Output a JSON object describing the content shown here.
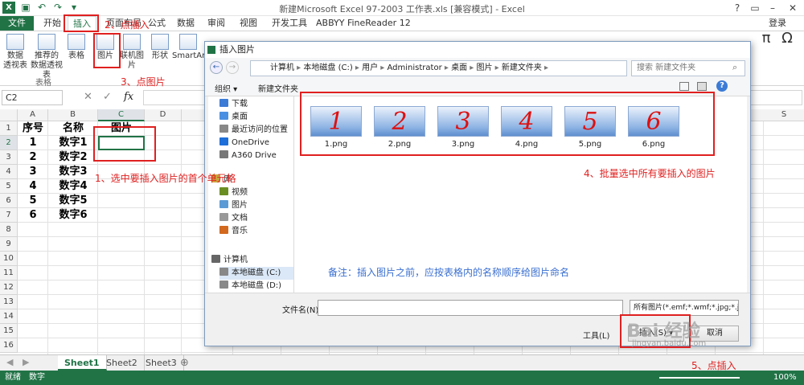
{
  "titlebar": {
    "title": "新建Microsoft Excel 97-2003 工作表.xls  [兼容模式] - Excel"
  },
  "tabs": {
    "file": "文件",
    "home": "开始",
    "insert": "插入",
    "layout": "页面布局",
    "formula": "公式",
    "data": "数据",
    "review": "审阅",
    "view": "视图",
    "dev": "开发工具",
    "abbyy": "ABBYY FineReader 12",
    "login": "登录"
  },
  "ribbon": {
    "pivot": "数据\n透视表",
    "recpivot": "推荐的\n数据透视表",
    "table": "表格",
    "group": "表格",
    "picture": "图片",
    "online": "联机图片",
    "shapes": "形状",
    "smartart": "SmartArt",
    "pi": "π",
    "omega": "Ω"
  },
  "formula": {
    "namebox": "C2",
    "fx": "fx"
  },
  "grid": {
    "columns": [
      "A",
      "B",
      "C",
      "D",
      "S"
    ],
    "rows": [
      "1",
      "2",
      "3",
      "4",
      "5",
      "6",
      "7",
      "8",
      "9",
      "10",
      "11",
      "12",
      "13",
      "14",
      "15",
      "16"
    ],
    "header": {
      "num": "序号",
      "name": "名称",
      "pic": "图片"
    },
    "data": [
      [
        "1",
        "数字1"
      ],
      [
        "2",
        "数字2"
      ],
      [
        "3",
        "数字3"
      ],
      [
        "4",
        "数字4"
      ],
      [
        "5",
        "数字5"
      ],
      [
        "6",
        "数字6"
      ]
    ]
  },
  "sheets": [
    "Sheet1",
    "Sheet2",
    "Sheet3"
  ],
  "status": {
    "ready": "就绪",
    "numlock": "数字",
    "zoom": "100%"
  },
  "dialog": {
    "title": "插入图片",
    "path": [
      "计算机",
      "本地磁盘 (C:)",
      "用户",
      "Administrator",
      "桌面",
      "图片",
      "新建文件夹"
    ],
    "search_placeholder": "搜索 新建文件夹",
    "organize": "组织 ▾",
    "newfolder": "新建文件夹",
    "nav": [
      "下载",
      "桌面",
      "最近访问的位置",
      "OneDrive",
      "A360 Drive",
      "库",
      "视频",
      "图片",
      "文档",
      "音乐",
      "计算机",
      "本地磁盘 (C:)",
      "本地磁盘 (D:)"
    ],
    "files": [
      {
        "num": "1",
        "name": "1.png"
      },
      {
        "num": "2",
        "name": "2.png"
      },
      {
        "num": "3",
        "name": "3.png"
      },
      {
        "num": "4",
        "name": "4.png"
      },
      {
        "num": "5",
        "name": "5.png"
      },
      {
        "num": "6",
        "name": "6.png"
      }
    ],
    "filename_label": "文件名(N):",
    "filetype": "所有图片(*.emf;*.wmf;*.jpg;*.ji",
    "tools": "工具(L)",
    "insert": "插入(S)",
    "cancel": "取消"
  },
  "annotations": {
    "a1": "1、选中要插入图片的首个单元格",
    "a2": "2、点插入",
    "a3": "3、点图片",
    "a4": "4、批量选中所有要插入的图片",
    "a5": "5、点插入",
    "note": "备注：插入图片之前，应按表格内的名称顺序给图片命名"
  },
  "watermark": {
    "text": "Bai 经验",
    "url": "jingyan.baidu.com"
  }
}
